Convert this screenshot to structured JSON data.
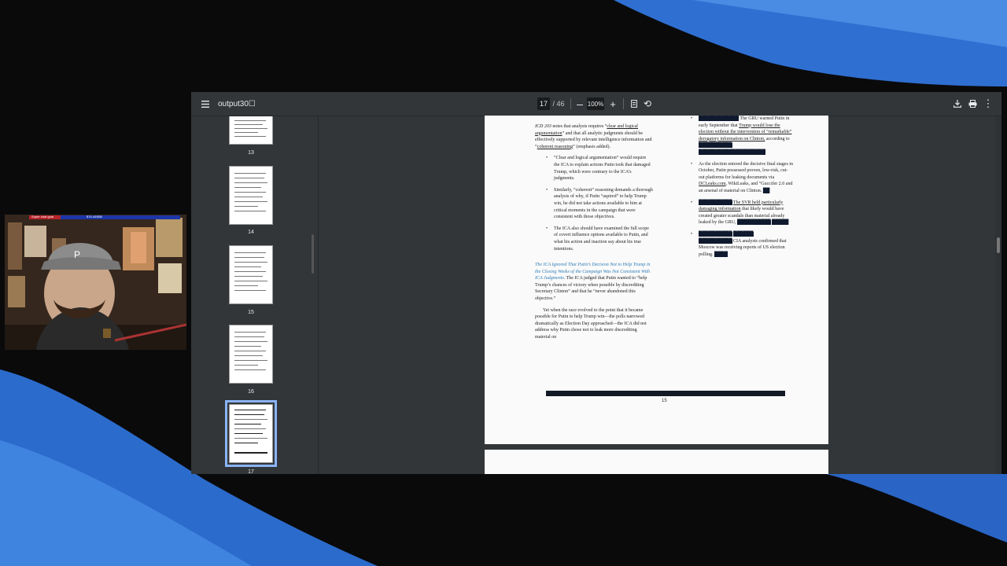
{
  "viewer": {
    "title": "output30☐",
    "current_page": "17",
    "total_pages": "/ 46",
    "zoom": "100%",
    "icons": [
      "menu-icon",
      "zoom-out-icon",
      "zoom-in-icon",
      "fit-page-icon",
      "rotate-icon",
      "download-icon",
      "print-icon",
      "more-icon"
    ]
  },
  "thumbnails": [
    {
      "label": "13"
    },
    {
      "label": "14"
    },
    {
      "label": "15"
    },
    {
      "label": "16"
    },
    {
      "label": "17",
      "selected": true
    }
  ],
  "page": {
    "left_col": {
      "p1_a": "ICD 203",
      "p1_b": " notes that analysis requires “",
      "p1_c": "clear and logical argumentation",
      "p1_d": "” and that all analytic judgments should be effectively supported by relevant intelligence information and “",
      "p1_e": "coherent reasoning",
      "p1_f": "” (emphasis added).",
      "b1": "“Clear and logical argumentation” would require the ICA to explain actions Putin took that damaged Trump, which were contrary to the ICA’s judgments.",
      "b2": "Similarly, “coherent” reasoning demands a thorough analysis of why, if Putin “aspired” to help Trump win, he did not take actions available to him at critical moments in the campaign that were consistent with those objectives.",
      "b3": "The ICA also should have examined the full scope of covert influence options available to Putin, and what his action and inaction say about his true intentions.",
      "h_blue": "The ICA Ignored That Putin’s Decision Not to Help Trump in the Closing Weeks of the Campaign Was Not Consistent With ICA Judgments.",
      "h_rest": " The ICA judged that Putin wanted to “help Trump’s chances of victory when possible by discrediting Secretary Clinton” and that he “never abandoned this objective.”",
      "p2": "Yet when the race evolved to the point that it became possible for Putin to help Trump win—the polls narrowed dramatically as Election Day approached—the ICA did not address why Putin chose not to leak more discrediting material on"
    },
    "right_col": {
      "b1_a": "The GRU warned Putin in early September that",
      "b1_b": "Trump would lose the election without the intervention of “remarkable” derogatory information on Clinton,",
      "b1_c": " according to",
      "b2_a": "As the election entered the decisive final stages in October, Putin possessed proven, low-risk, cut-out platforms for leaking documents via ",
      "b2_b": "DCLeaks.com",
      "b2_c": ", WikiLeaks, and “Guccifer 2.0 and an arsenal of material on Clinton.",
      "b3_a": "The SVR held particularly damaging information",
      "b3_b": " that likely would have created greater scandals than material already leaked by the GRU,",
      "b4": "CIA analysts confirmed that Moscow was receiving reports of US election polling."
    },
    "page_number": "15"
  },
  "stream_overlay": {
    "top_bar_text_left": "Super chat goal",
    "top_bar_text_mid": "$76.40/$50",
    "hat_logo": "P"
  }
}
